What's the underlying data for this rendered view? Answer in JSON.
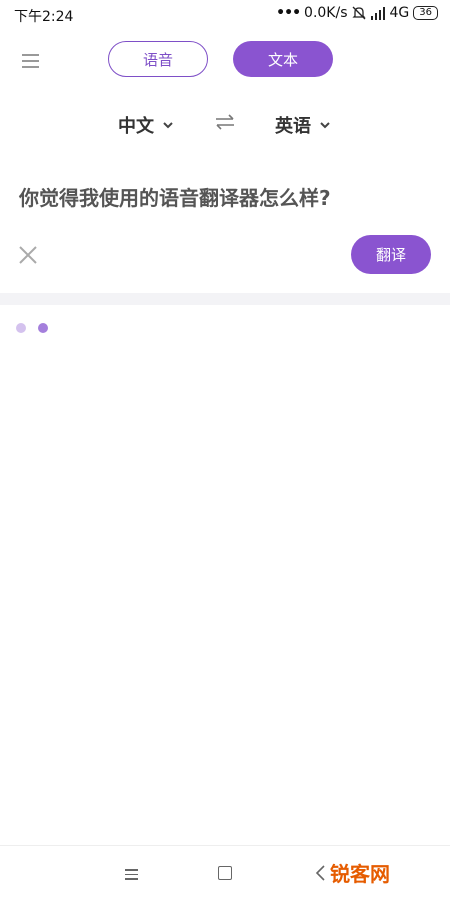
{
  "status_bar": {
    "time": "下午2:24",
    "network_speed": "0.0K/s",
    "network_type": "4G",
    "battery": "36"
  },
  "header": {
    "tabs": [
      {
        "label": "语音",
        "active": false
      },
      {
        "label": "文本",
        "active": true
      }
    ]
  },
  "languages": {
    "source": "中文",
    "target": "英语"
  },
  "input": {
    "text": "你觉得我使用的语音翻译器怎么样?"
  },
  "actions": {
    "translate_label": "翻译"
  },
  "watermark": {
    "text": "锐客网"
  },
  "colors": {
    "accent": "#8a54d0",
    "loading_dot_light": "#d4c2ee",
    "loading_dot_dark": "#a47fdc"
  }
}
